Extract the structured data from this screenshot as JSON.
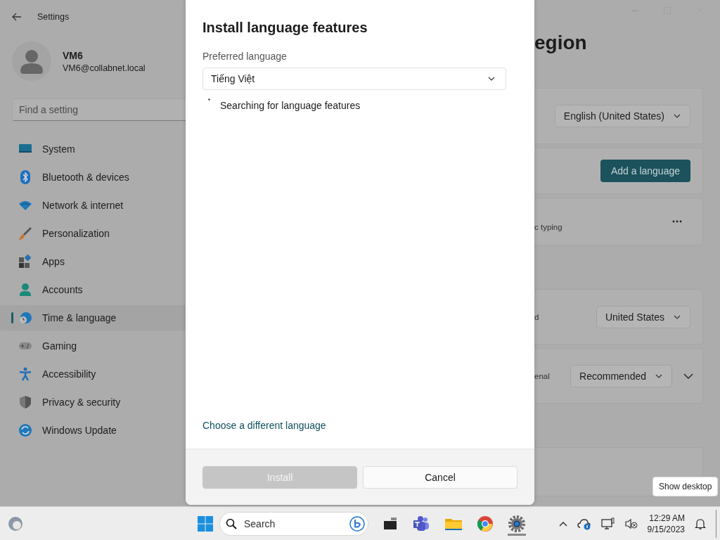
{
  "settings": {
    "title": "Settings",
    "user": {
      "name": "VM6",
      "email": "VM6@collabnet.local"
    },
    "search": {
      "placeholder": "Find a setting"
    },
    "nav": [
      {
        "label": "System",
        "selected": false
      },
      {
        "label": "Bluetooth & devices",
        "selected": false
      },
      {
        "label": "Network & internet",
        "selected": false
      },
      {
        "label": "Personalization",
        "selected": false
      },
      {
        "label": "Apps",
        "selected": false
      },
      {
        "label": "Accounts",
        "selected": false
      },
      {
        "label": "Time & language",
        "selected": true
      },
      {
        "label": "Gaming",
        "selected": false
      },
      {
        "label": "Accessibility",
        "selected": false
      },
      {
        "label": "Privacy & security",
        "selected": false
      },
      {
        "label": "Windows Update",
        "selected": false
      }
    ],
    "page_heading": "egion",
    "cards": [
      {
        "kind": "dropdown",
        "value": "English (United States)"
      },
      {
        "kind": "button",
        "label": "Add a language"
      },
      {
        "kind": "more",
        "text": "c typing"
      },
      {
        "kind": "dropdown",
        "text": "d",
        "value": "United States"
      },
      {
        "kind": "dropdown",
        "text": "enal",
        "value": "Recommended",
        "expander": true
      },
      {
        "kind": "blank"
      }
    ]
  },
  "dialog": {
    "title": "Install language features",
    "label": "Preferred language",
    "select": {
      "value": "Tiếng Việt"
    },
    "status": "Searching for language features",
    "link": "Choose a different language",
    "buttons": [
      {
        "label": "Install",
        "disabled": true
      },
      {
        "label": "Cancel",
        "disabled": false
      }
    ]
  },
  "taskbar": {
    "search_placeholder": "Search",
    "time": "12:29 AM",
    "date": "9/15/2023",
    "tooltip": "Show desktop"
  }
}
